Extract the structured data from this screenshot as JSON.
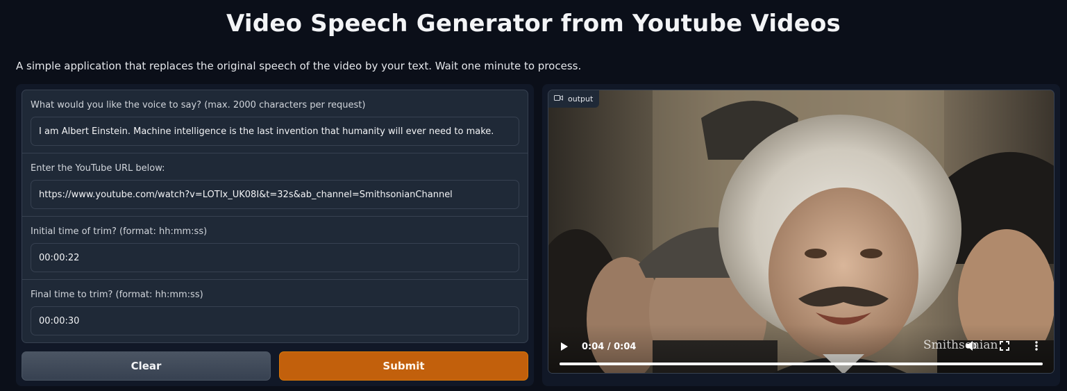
{
  "page": {
    "title": "Video Speech Generator from Youtube Videos",
    "description": "A simple application that replaces the original speech of the video by your text. Wait one minute to process."
  },
  "form": {
    "fields": [
      {
        "label": "What would you like the voice to say? (max. 2000 characters per request)",
        "value": "I am Albert Einstein. Machine intelligence is the last invention that humanity will ever need to make."
      },
      {
        "label": "Enter the YouTube URL below:",
        "value": "https://www.youtube.com/watch?v=LOTIx_UK08I&t=32s&ab_channel=SmithsonianChannel"
      },
      {
        "label": "Initial time of trim? (format: hh:mm:ss)",
        "value": "00:00:22"
      },
      {
        "label": "Final time to trim? (format: hh:mm:ss)",
        "value": "00:00:30"
      }
    ],
    "clear_label": "Clear",
    "submit_label": "Submit"
  },
  "output": {
    "label": "output",
    "icon": "video-camera-icon",
    "time": "0:04 / 0:04",
    "watermark": "Smithsonian",
    "progress": 1.0
  },
  "colors": {
    "background": "#0b0f19",
    "panel": "#111827",
    "block": "#1f2937",
    "border": "#374151",
    "submit": "#c2600c"
  }
}
